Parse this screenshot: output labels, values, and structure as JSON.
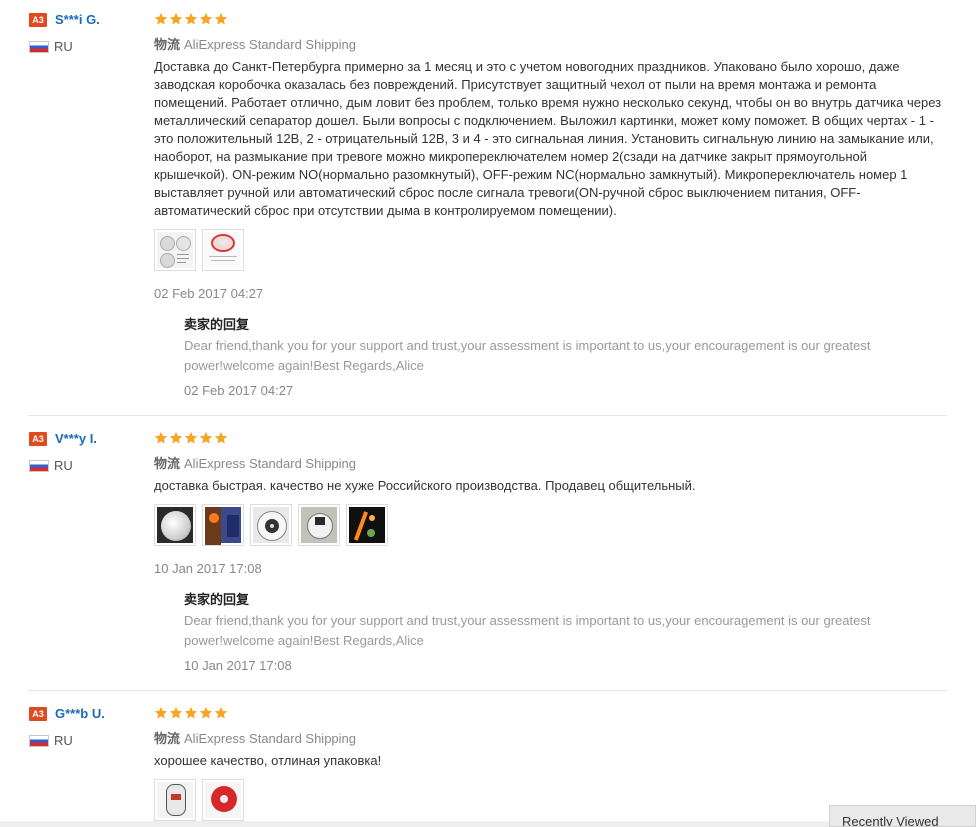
{
  "reviews": [
    {
      "badge": "A3",
      "username": "S***i G.",
      "country": "RU",
      "rating": 5,
      "shipping_label": "物流",
      "shipping_method": "AliExpress Standard Shipping",
      "text": "Доставка до Санкт-Петербурга примерно за 1 месяц и это с учетом новогодних праздников. Упаковано было хорошо, даже заводская коробочка оказалась без повреждений. Присутствует защитный чехол от пыли на время монтажа и ремонта помещений. Работает отлично, дым ловит без проблем, только время нужно несколько секунд, чтобы он во внутрь датчика через металлический сепаратор дошел. Были вопросы с подключением. Выложил картинки, может кому поможет. В общих чертах - 1 - это положительный 12В, 2 - отрицательный 12В, 3 и 4 - это сигнальная линия. Установить сигнальную линию на замыкание или, наоборот, на размыкание при тревоге можно микропереключателем номер 2(сзади на датчике закрыт прямоугольной крышечкой). ON-режим NO(нормально разомкнутый), OFF-режим NC(нормально замкнутый). Микропереключатель номер 1 выставляет ручной или автоматический сброс после сигнала тревоги(ON-ручной сброс выключением питания, OFF-автоматический сброс при отсутствии дыма в контролируемом помещении).",
      "photos": [
        "diagram-photo",
        "detector-photo"
      ],
      "date": "02 Feb 2017 04:27",
      "reply_title": "卖家的回复",
      "reply_text": "Dear friend,thank you for your support and trust,your assessment is important to us,your encouragement is our greatest power!welcome again!Best Regards,Alice",
      "reply_date": "02 Feb 2017 04:27"
    },
    {
      "badge": "A3",
      "username": "V***y I.",
      "country": "RU",
      "rating": 5,
      "shipping_label": "物流",
      "shipping_method": "AliExpress Standard Shipping",
      "text": "доставка быстрая. качество не хуже Российского производства. Продавец общительный.",
      "photos": [
        "detector-front-photo",
        "board-photo",
        "detector-back-photo",
        "detector-box-photo",
        "detector-lit-photo"
      ],
      "date": "10 Jan 2017 17:08",
      "reply_title": "卖家的回复",
      "reply_text": "Dear friend,thank you for your support and trust,your assessment is important to us,your encouragement is our greatest power!welcome again!Best Regards,Alice",
      "reply_date": "10 Jan 2017 17:08"
    },
    {
      "badge": "A3",
      "username": "G***b U.",
      "country": "RU",
      "rating": 5,
      "shipping_label": "物流",
      "shipping_method": "AliExpress Standard Shipping",
      "text": "хорошее качество, отлиная упаковка!",
      "photos": [
        "detector-side-photo",
        "red-detector-photo"
      ]
    }
  ],
  "recently_viewed": "Recently Viewed",
  "colors": {
    "star": "#f5a623",
    "badge": "#e04a1e",
    "username": "#1a6bb8"
  }
}
